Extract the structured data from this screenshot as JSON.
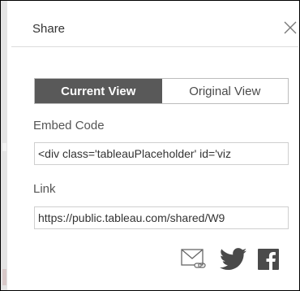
{
  "dialog": {
    "title": "Share"
  },
  "tabs": [
    {
      "label": "Current View",
      "active": true
    },
    {
      "label": "Original View",
      "active": false
    }
  ],
  "embed": {
    "label": "Embed Code",
    "value": "<div class='tableauPlaceholder' id='viz"
  },
  "link": {
    "label": "Link",
    "value": "https://public.tableau.com/shared/W9"
  },
  "share_icons": [
    "email-link-icon",
    "twitter-icon",
    "facebook-icon"
  ],
  "colors": {
    "active_tab_bg": "#595959",
    "icon_color": "#4a4a4a"
  }
}
